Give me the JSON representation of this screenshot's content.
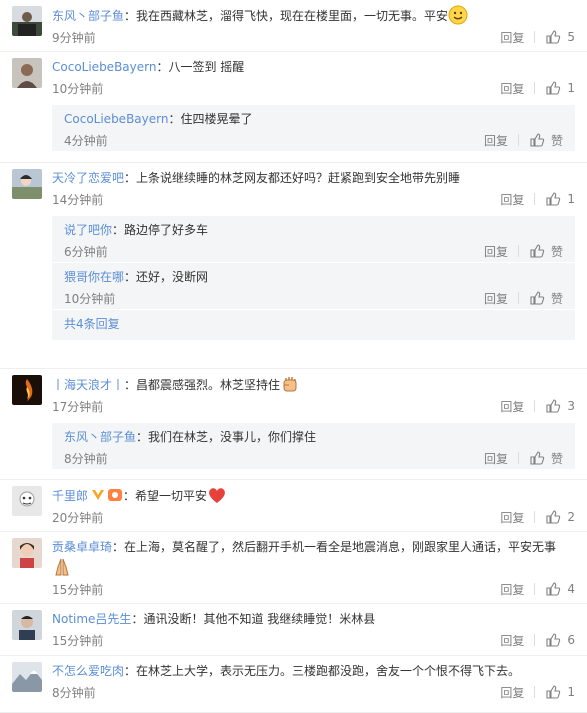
{
  "reply_label": "回复",
  "like_label": "赞",
  "separator": "：",
  "more_replies": "共4条回复",
  "comments": [
    {
      "user": "东风丶部子鱼",
      "text": "我在西藏林芝，溜得飞快，现在在楼里面，一切无事。平安",
      "emoji": "smile-emoji",
      "time": "9分钟前",
      "likes": "5"
    },
    {
      "user": "CocoLiebeBayern",
      "text": "八一签到 摇醒",
      "time": "10分钟前",
      "likes": "1",
      "replies": [
        {
          "user": "CocoLiebeBayern",
          "text": "住四楼晃晕了",
          "time": "4分钟前"
        }
      ]
    },
    {
      "user": "天冷了恋爱吧",
      "text": "上条说继续睡的林芝网友都还好吗？赶紧跑到安全地带先别睡",
      "time": "14分钟前",
      "likes": "1",
      "replies": [
        {
          "user": "说了吧你",
          "text": "路边停了好多车",
          "time": "6分钟前"
        },
        {
          "user": "猥哥你在哪",
          "text": "还好，没断网",
          "time": "10分钟前"
        }
      ]
    },
    {
      "user": "丨海天浪才丨",
      "text": "昌都震感强烈。林芝坚持住",
      "emoji": "fist-emoji",
      "time": "17分钟前",
      "likes": "3",
      "replies": [
        {
          "user": "东风丶部子鱼",
          "text": "我们在林芝，没事儿，你们撑住",
          "time": "8分钟前"
        }
      ]
    },
    {
      "user": "千里郎",
      "text": "希望一切平安",
      "emoji": "heart-emoji",
      "time": "20分钟前",
      "likes": "2"
    },
    {
      "user": "贡桑卓卓琦",
      "text": "在上海，莫名醒了，然后翻开手机一看全是地震消息，刚跟家里人通话，平安无事",
      "emoji": "pray-emoji",
      "time": "15分钟前",
      "likes": "4"
    },
    {
      "user": "Notime吕先生",
      "text": "通讯没断！其他不知道 我继续睡觉！米林县",
      "time": "15分钟前",
      "likes": "6"
    },
    {
      "user": "不怎么爱吃肉",
      "text": "在林芝上大学，表示无压力。三楼跑都没跑，舍友一个个恨不得飞下去。",
      "time": "8分钟前",
      "likes": "1"
    }
  ],
  "colors": {
    "link": "#5b8ed6",
    "text": "#333333",
    "meta": "#808080",
    "reply_bg": "#f4f5f6"
  }
}
